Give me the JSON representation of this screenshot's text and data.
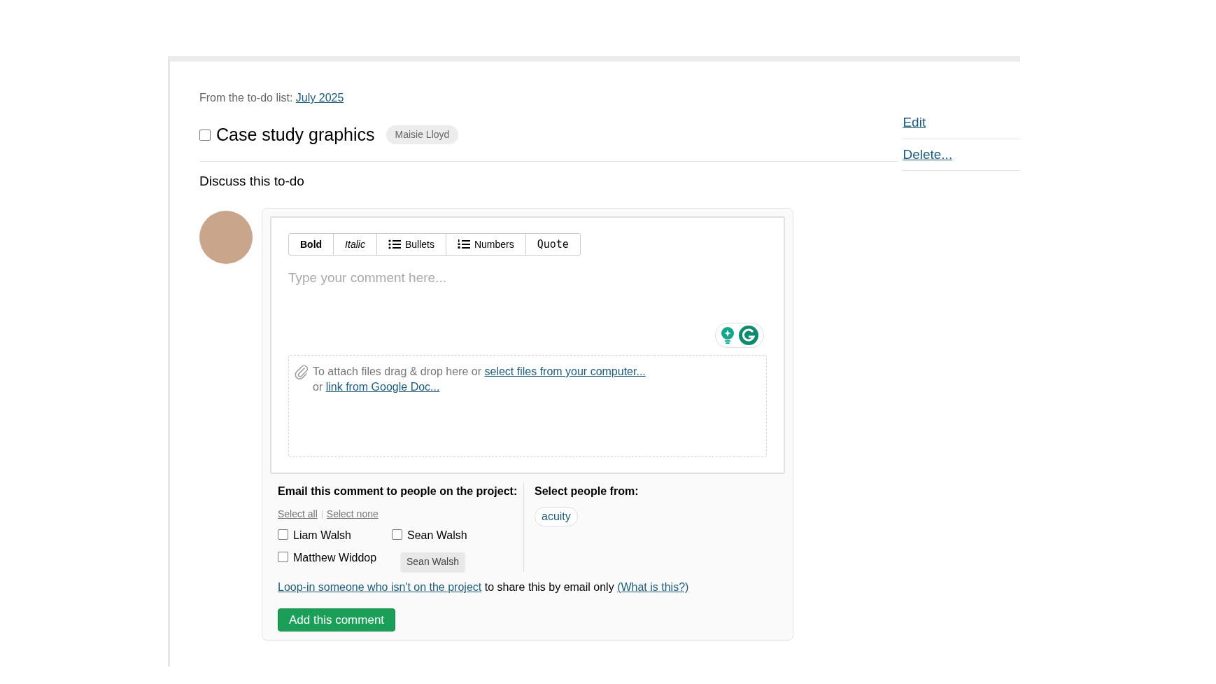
{
  "breadcrumb": {
    "label": "From the to-do list:",
    "link": "July 2025"
  },
  "todo": {
    "checked": false,
    "title": "Case study graphics",
    "assignee": "Maisie Lloyd"
  },
  "actions": [
    "Edit",
    "Delete..."
  ],
  "discussion": {
    "heading": "Discuss this to-do"
  },
  "toolbar": [
    {
      "kind": "bold",
      "label": "Bold"
    },
    {
      "kind": "italic",
      "label": "Italic"
    },
    {
      "kind": "bullets",
      "label": "Bullets"
    },
    {
      "kind": "numbers",
      "label": "Numbers"
    },
    {
      "kind": "quote",
      "label": "Quote"
    }
  ],
  "comment": {
    "placeholder": "Type your comment here..."
  },
  "attach": {
    "text": "To attach files drag & drop here or",
    "link": "select files from your computer...",
    "or": "or",
    "link2": "link from Google Doc..."
  },
  "email": {
    "heading": "Email this comment to people on the project:",
    "select_all": "Select all",
    "select_none": "Select none",
    "people": [
      {
        "name": "Liam Walsh",
        "checked": false
      },
      {
        "name": "Sean Walsh",
        "checked": false
      },
      {
        "name": "Matthew Widdop",
        "checked": false
      }
    ],
    "tooltip": "Sean Walsh"
  },
  "groups": {
    "heading": "Select people from:",
    "items": [
      "acuity"
    ]
  },
  "loop_in": {
    "link": "Loop-in someone who isn't on the project",
    "text": "to share this by email only",
    "help": "(What is this?)"
  },
  "submit": "Add this comment"
}
